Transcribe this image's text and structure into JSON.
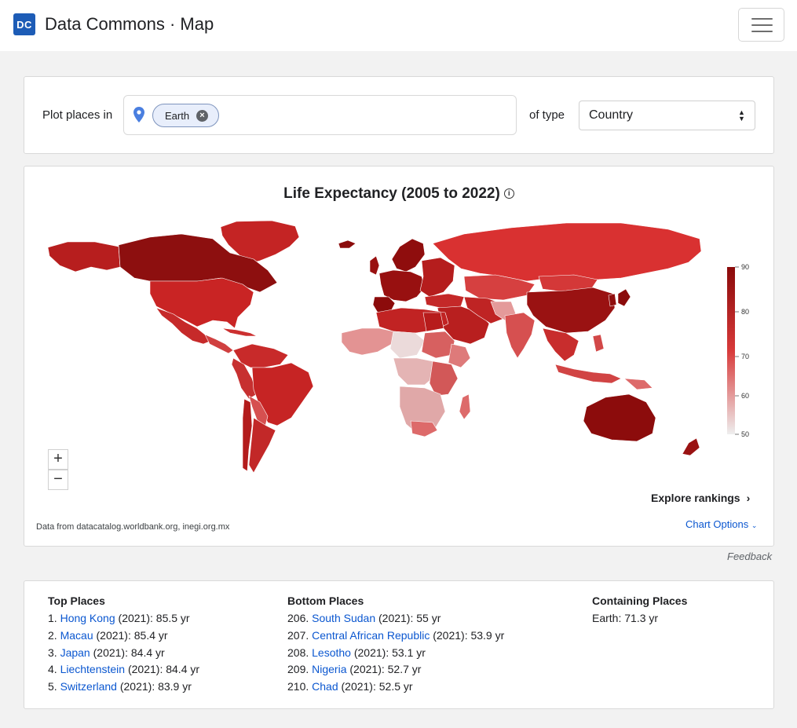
{
  "header": {
    "logo_text": "DC",
    "title": "Data Commons · Map",
    "menu_icon": "hamburger-icon"
  },
  "search": {
    "plot_label": "Plot places in",
    "place_chip": "Earth",
    "type_label": "of type",
    "type_value": "Country"
  },
  "map": {
    "title": "Life Expectancy (2005 to 2022)",
    "legend_ticks": [
      "90",
      "80",
      "70",
      "60",
      "50"
    ],
    "legend_range": [
      50,
      90
    ],
    "color_scale": [
      "#eaeaea",
      "#d64545",
      "#8b0b0b"
    ],
    "zoom_in": "+",
    "zoom_out": "−",
    "explore_label": "Explore rankings",
    "source": "Data from datacatalog.worldbank.org, inegi.org.mx",
    "chart_options": "Chart Options"
  },
  "feedback": "Feedback",
  "rankings": {
    "top_heading": "Top Places",
    "top": [
      {
        "rank": "1.",
        "name": "Hong Kong",
        "value": "(2021): 85.5 yr"
      },
      {
        "rank": "2.",
        "name": "Macau",
        "value": "(2021): 85.4 yr"
      },
      {
        "rank": "3.",
        "name": "Japan",
        "value": "(2021): 84.4 yr"
      },
      {
        "rank": "4.",
        "name": "Liechtenstein",
        "value": "(2021): 84.4 yr"
      },
      {
        "rank": "5.",
        "name": "Switzerland",
        "value": "(2021): 83.9 yr"
      }
    ],
    "bottom_heading": "Bottom Places",
    "bottom": [
      {
        "rank": "206.",
        "name": "South Sudan",
        "value": "(2021): 55 yr"
      },
      {
        "rank": "207.",
        "name": "Central African Republic",
        "value": "(2021): 53.9 yr"
      },
      {
        "rank": "208.",
        "name": "Lesotho",
        "value": "(2021): 53.1 yr"
      },
      {
        "rank": "209.",
        "name": "Nigeria",
        "value": "(2021): 52.7 yr"
      },
      {
        "rank": "210.",
        "name": "Chad",
        "value": "(2021): 52.5 yr"
      }
    ],
    "containing_heading": "Containing Places",
    "containing": "Earth: 71.3 yr"
  }
}
